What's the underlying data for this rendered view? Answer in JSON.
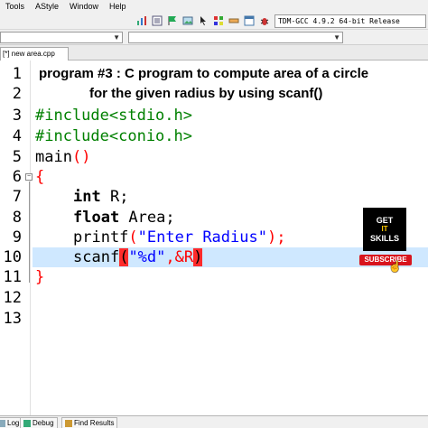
{
  "menu": [
    "Tools",
    "AStyle",
    "Window",
    "Help"
  ],
  "toolbar": {
    "icons": [
      "chart-icon",
      "checklist-icon",
      "flag-icon",
      "image-icon",
      "cursor-icon",
      "grid-icon",
      "ruler-icon",
      "window-icon",
      "bug-icon",
      "no-entry-icon"
    ],
    "compiler": "TDM-GCC 4.9.2 64-bit Release"
  },
  "tab": {
    "label": "[*] new area.cpp"
  },
  "editor": {
    "line_numbers": [
      "1",
      "2",
      "3",
      "4",
      "5",
      "6",
      "7",
      "8",
      "9",
      "10",
      "11",
      "12",
      "13"
    ],
    "comment_line1": "program #3 : C program to compute area of a circle",
    "comment_line2": "for the given radius by using scanf()",
    "include1": "#include<stdio.h>",
    "include2": "#include<conio.h>",
    "main_name": "main",
    "main_parens": "()",
    "open_brace": "{",
    "decl_int_kw": "int",
    "decl_int_rest": " R;",
    "decl_float_kw": "float",
    "decl_float_rest": " Area;",
    "printf_name": "printf",
    "printf_open": "(",
    "printf_string": "\"Enter Radius\"",
    "printf_close": ");",
    "scanf_name": "scanf",
    "scanf_open": "(",
    "scanf_string": "\"%d\"",
    "scanf_rest": ",&R",
    "scanf_close": ")",
    "close_brace": "}",
    "active_line": "10"
  },
  "badge": {
    "top": "GET",
    "middle": "IT",
    "bottom": "SKILLS",
    "subscribe": "SUBSCRIBE"
  },
  "bottom_tabs": [
    "Log",
    "Debug",
    "Find Results"
  ],
  "colors": {
    "highlight": "#cfe8ff",
    "preprocessor": "#008000",
    "string": "#0000ff",
    "symbol": "#ff0000",
    "bracket_match": "#ff2b2b",
    "subscribe": "#d8141d"
  }
}
